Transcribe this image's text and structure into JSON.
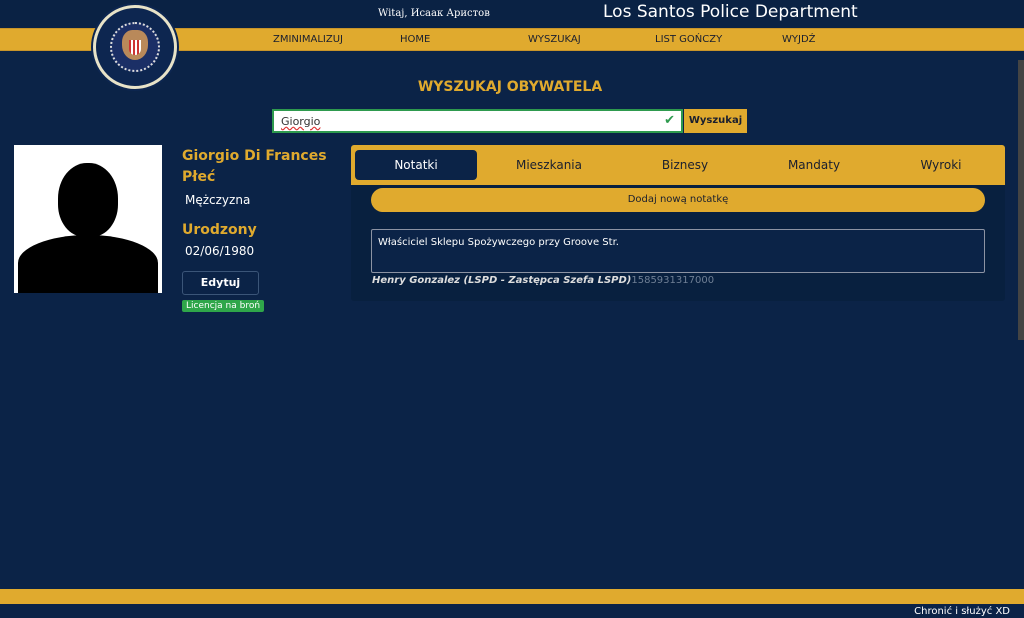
{
  "header": {
    "greeting": "Witaj, Исаак Аристов",
    "title": "Los Santos Police Department",
    "logo_text": "LOS SANTOS POLICE DEPARTMENT"
  },
  "nav": [
    {
      "label": "ZMINIMALIZUJ"
    },
    {
      "label": "HOME"
    },
    {
      "label": "WYSZUKAJ"
    },
    {
      "label": "LIST GOŃCZY"
    },
    {
      "label": "WYJDŹ"
    }
  ],
  "search": {
    "heading": "WYSZUKAJ OBYWATELA",
    "value": "Giorgio",
    "button": "Wyszukaj",
    "valid_icon": "check-icon"
  },
  "profile": {
    "name": "Giorgio Di Frances",
    "gender_label": "Płeć",
    "gender": "Mężczyzna",
    "born_label": "Urodzony",
    "born": "02/06/1980",
    "edit_button": "Edytuj profil",
    "license_badge": "Licencja na broń"
  },
  "tabs": [
    {
      "label": "Notatki",
      "active": true
    },
    {
      "label": "Mieszkania"
    },
    {
      "label": "Biznesy"
    },
    {
      "label": "Mandaty"
    },
    {
      "label": "Wyroki"
    }
  ],
  "notes": {
    "add_button": "Dodaj nową notatkę",
    "items": [
      {
        "text": "Właściciel Sklepu Spożywczego przy Groove Str.",
        "author": "Henry Gonzalez (LSPD - Zastępca Szefa LSPD)",
        "timestamp": "1585931317000"
      }
    ]
  },
  "footer": {
    "text": "Chronić i służyć XD"
  },
  "colors": {
    "background": "#0b2347",
    "accent": "#e0aa2e",
    "success": "#2fa64a"
  }
}
